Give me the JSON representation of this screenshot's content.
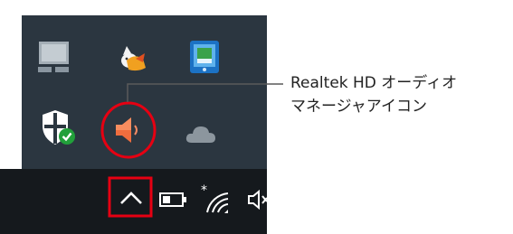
{
  "annotation": {
    "line1": "Realtek HD オーディオ",
    "line2": "マネージャアイコン",
    "highlight_color": "#e60012"
  },
  "tray_popup": {
    "icons": [
      "network-monitor-icon",
      "cat-app-icon",
      "tablet-app-icon",
      "windows-defender-icon",
      "speaker-icon",
      "onedrive-cloud-icon"
    ]
  },
  "taskbar": {
    "icons": [
      "show-hidden-icons-chevron-icon",
      "battery-icon",
      "wifi-icon",
      "volume-icon"
    ]
  },
  "colors": {
    "popup_bg": "#2b3640",
    "taskbar_bg": "#15191d",
    "accent_red": "#e60012"
  }
}
